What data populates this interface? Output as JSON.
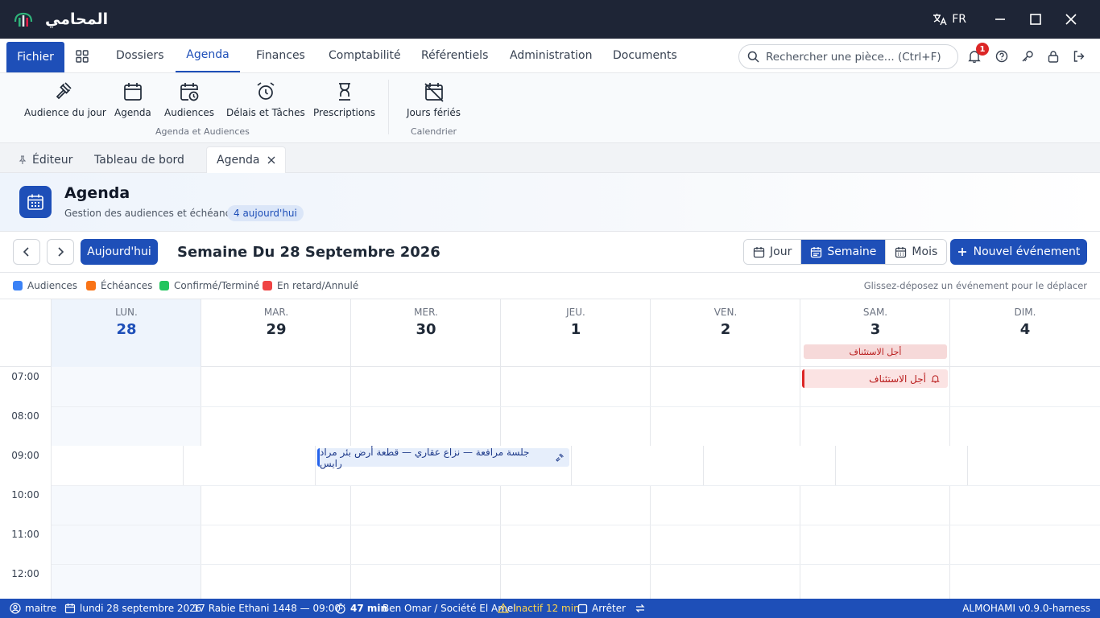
{
  "app": {
    "title": "المحامي",
    "language": "FR"
  },
  "menu": {
    "fichier": "Fichier",
    "items": [
      "Dossiers",
      "Agenda",
      "Finances",
      "Comptabilité",
      "Référentiels",
      "Administration",
      "Documents"
    ],
    "active": "Agenda"
  },
  "search": {
    "placeholder": "Rechercher une pièce... (Ctrl+F)"
  },
  "notifications": {
    "count": "1"
  },
  "ribbon": {
    "groups": [
      {
        "label": "Agenda et Audiences",
        "items": [
          "Audience du jour",
          "Agenda",
          "Audiences",
          "Délais et Tâches",
          "Prescriptions"
        ]
      },
      {
        "label": "Calendrier",
        "items": [
          "Jours fériés"
        ]
      }
    ]
  },
  "doc_tabs": {
    "editor": "Éditeur",
    "dashboard": "Tableau de bord",
    "agenda": "Agenda"
  },
  "page": {
    "title": "Agenda",
    "subtitle": "Gestion des audiences et échéances",
    "today_badge": "4 aujourd'hui"
  },
  "toolbar": {
    "today": "Aujourd'hui",
    "week_title": "Semaine Du 28 Septembre 2026",
    "views": [
      "Jour",
      "Semaine",
      "Mois"
    ],
    "active_view": "Semaine",
    "new_event": "Nouvel événement"
  },
  "legend": {
    "items": [
      {
        "label": "Audiences",
        "color": "#3b82f6"
      },
      {
        "label": "Échéances",
        "color": "#f97316"
      },
      {
        "label": "Confirmé/Terminé",
        "color": "#22c55e"
      },
      {
        "label": "En retard/Annulé",
        "color": "#ef4444"
      }
    ],
    "hint": "Glissez-déposez un événement pour le déplacer"
  },
  "calendar": {
    "days": [
      {
        "name": "LUN.",
        "num": "28",
        "today": true
      },
      {
        "name": "MAR.",
        "num": "29"
      },
      {
        "name": "MER.",
        "num": "30"
      },
      {
        "name": "JEU.",
        "num": "1"
      },
      {
        "name": "VEN.",
        "num": "2"
      },
      {
        "name": "SAM.",
        "num": "3"
      },
      {
        "name": "DIM.",
        "num": "4"
      }
    ],
    "times": [
      "07:00",
      "08:00",
      "09:00",
      "10:00",
      "11:00",
      "12:00"
    ],
    "allday_event": "أجل الاستئناف",
    "events": {
      "deadline": "أجل الاستئناف",
      "hearing": "جلسة مرافعة — نزاع عقاري — قطعة أرض بئر مراد رايس"
    }
  },
  "status": {
    "user": "maitre",
    "date": "lundi 28 septembre 2026",
    "hijri": "· 17 Rabie Ethani 1448 — 09:00",
    "timer": "47 min",
    "client": "Ben Omar / Société El Amel",
    "inactive": "inactif 12 min",
    "stop": "Arrêter",
    "version": "ALMOHAMI v0.9.0-harness"
  },
  "colors": {
    "primary": "#1e4fb8",
    "titlebar": "#1e2536",
    "danger": "#dc2626"
  }
}
